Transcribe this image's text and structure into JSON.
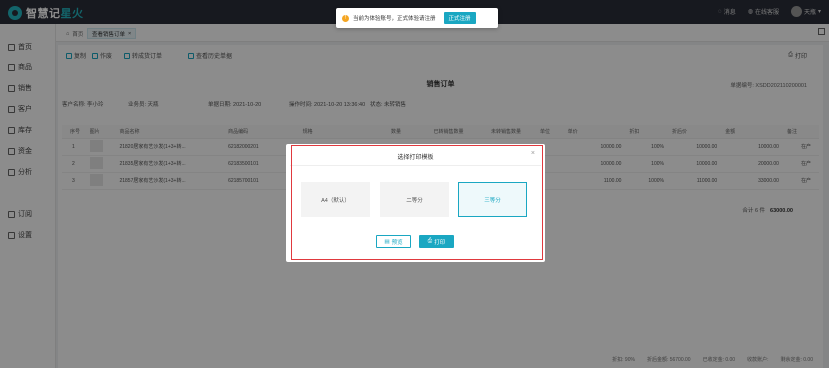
{
  "app": {
    "logo_a": "智慧记",
    "logo_b": "星火"
  },
  "topbar": {
    "messages": "消息",
    "support": "在线客服",
    "user": "天瓶"
  },
  "notice": {
    "text": "当前为体验账号，正式体验请注册",
    "button": "正式注册"
  },
  "sidebar": {
    "items": [
      "首页",
      "商品",
      "销售",
      "客户",
      "库存",
      "资金",
      "分析",
      "订阅",
      "设置"
    ]
  },
  "tabs": {
    "home": "首页",
    "active": "查看销售订单"
  },
  "toolbar": {
    "copy": "复制",
    "void": "作废",
    "to_sales": "转成货订单",
    "history": "查看历史单据",
    "print": "打印"
  },
  "doc": {
    "title": "销售订单",
    "docno": "单据编号: XSDD202110200001",
    "customer": "客户名称: 李小玲",
    "salesperson": "业务员: 天瓶",
    "date": "单据日期: 2021-10-20",
    "optime": "操作时间: 2021-10-20 13:36:40",
    "status": "状态: 未转销售"
  },
  "table": {
    "headers": [
      "序号",
      "图片",
      "商品名称",
      "商品编码",
      "规格",
      "数量",
      "已转销售数量",
      "未转销售数量",
      "单位",
      "单价",
      "折扣",
      "折后价",
      "金额",
      "备注"
    ],
    "rows": [
      [
        "1",
        "",
        "21820居家有艺沙发(1+3+转...",
        "62182000201",
        "",
        "",
        "",
        "",
        "",
        "10000.00",
        "100%",
        "10000.00",
        "10000.00",
        "在产"
      ],
      [
        "2",
        "",
        "21835居家有艺沙发(1+3+转...",
        "62183500101",
        "",
        "",
        "",
        "",
        "",
        "10000.00",
        "100%",
        "10000.00",
        "20000.00",
        "在产"
      ],
      [
        "3",
        "",
        "21857居家有艺沙发(1+3+转...",
        "62185700101",
        "",
        "",
        "",
        "",
        "",
        "1100.00",
        "1000%",
        "11000.00",
        "33000.00",
        "在产"
      ]
    ]
  },
  "total": {
    "label": "合计 6 件",
    "amount": "63000.00"
  },
  "footer": {
    "discount": "折扣: 90%",
    "after": "折后金额: 56700.00",
    "received": "已收定金: 0.00",
    "account": "收款账户:",
    "remain": "剩余定金: 0.00"
  },
  "dialog": {
    "title": "选择打印模板",
    "options": [
      "A4（默认）",
      "二等分",
      "三等分"
    ],
    "selected_index": 2,
    "preview": "预览",
    "print": "打印"
  }
}
